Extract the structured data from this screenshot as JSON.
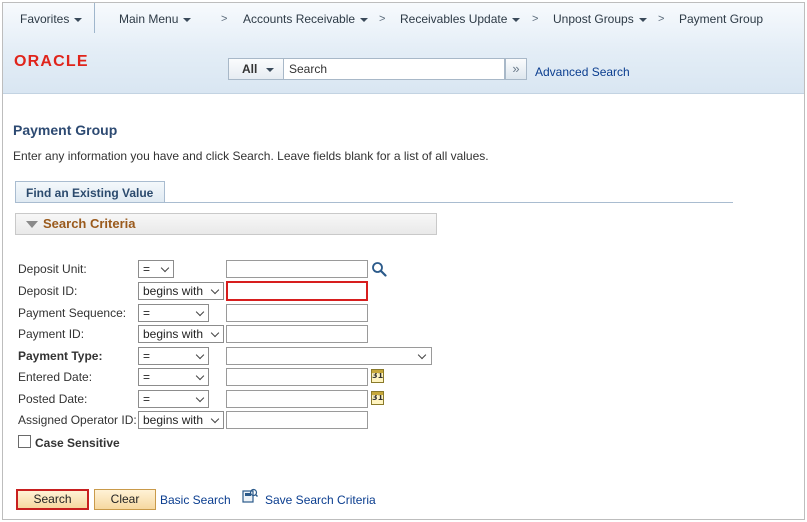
{
  "nav": {
    "favorites": "Favorites",
    "main_menu": "Main Menu",
    "breadcrumb_separator": ">",
    "crumbs": [
      "Accounts Receivable",
      "Receivables Update",
      "Unpost Groups",
      "Payment Group"
    ]
  },
  "logo": "ORACLE",
  "search": {
    "scope": "All",
    "placeholder": "Search",
    "go_glyph": "»",
    "advanced_link": "Advanced Search"
  },
  "page": {
    "title": "Payment Group",
    "instructions": "Enter any information you have and click Search. Leave fields blank for a list of all values.",
    "tab": "Find an Existing Value",
    "criteria_header": "Search Criteria"
  },
  "fields": [
    {
      "label": "Deposit Unit:",
      "operator": "=",
      "value": "",
      "icon": "lookup-icon"
    },
    {
      "label": "Deposit ID:",
      "operator": "begins with",
      "value": ""
    },
    {
      "label": "Payment Sequence:",
      "operator": "=",
      "value": ""
    },
    {
      "label": "Payment ID:",
      "operator": "begins with",
      "value": ""
    },
    {
      "label": "Payment Type:",
      "operator": "=",
      "value": "",
      "required": true
    },
    {
      "label": "Entered Date:",
      "operator": "=",
      "value": "",
      "icon": "calendar-icon"
    },
    {
      "label": "Posted Date:",
      "operator": "=",
      "value": "",
      "icon": "calendar-icon"
    },
    {
      "label": "Assigned Operator ID:",
      "operator": "begins with",
      "value": ""
    }
  ],
  "calendar_glyph": "31",
  "case_sensitive": {
    "label": "Case Sensitive",
    "checked": false
  },
  "actions": {
    "search": "Search",
    "clear": "Clear",
    "basic_search": "Basic Search",
    "save_criteria": "Save Search Criteria"
  },
  "colors": {
    "oracle_red": "#e0241b",
    "focus_border": "#d71e1e",
    "link_blue": "#0a3d8f",
    "criteria_text": "#9a5a1c"
  }
}
